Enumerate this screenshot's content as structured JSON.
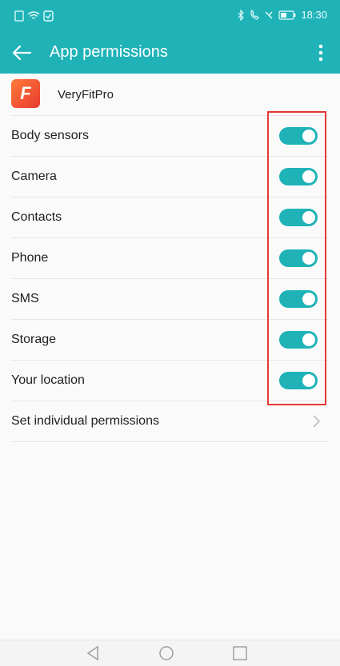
{
  "status": {
    "time": "18:30"
  },
  "appbar": {
    "title": "App permissions"
  },
  "app": {
    "name": "VeryFitPro",
    "icon_letter": "F"
  },
  "permissions": [
    {
      "label": "Body sensors",
      "enabled": true
    },
    {
      "label": "Camera",
      "enabled": true
    },
    {
      "label": "Contacts",
      "enabled": true
    },
    {
      "label": "Phone",
      "enabled": true
    },
    {
      "label": "SMS",
      "enabled": true
    },
    {
      "label": "Storage",
      "enabled": true
    },
    {
      "label": "Your location",
      "enabled": true
    }
  ],
  "individual": {
    "label": "Set individual permissions"
  },
  "colors": {
    "accent": "#1fb3b8",
    "highlight": "#e53935"
  }
}
